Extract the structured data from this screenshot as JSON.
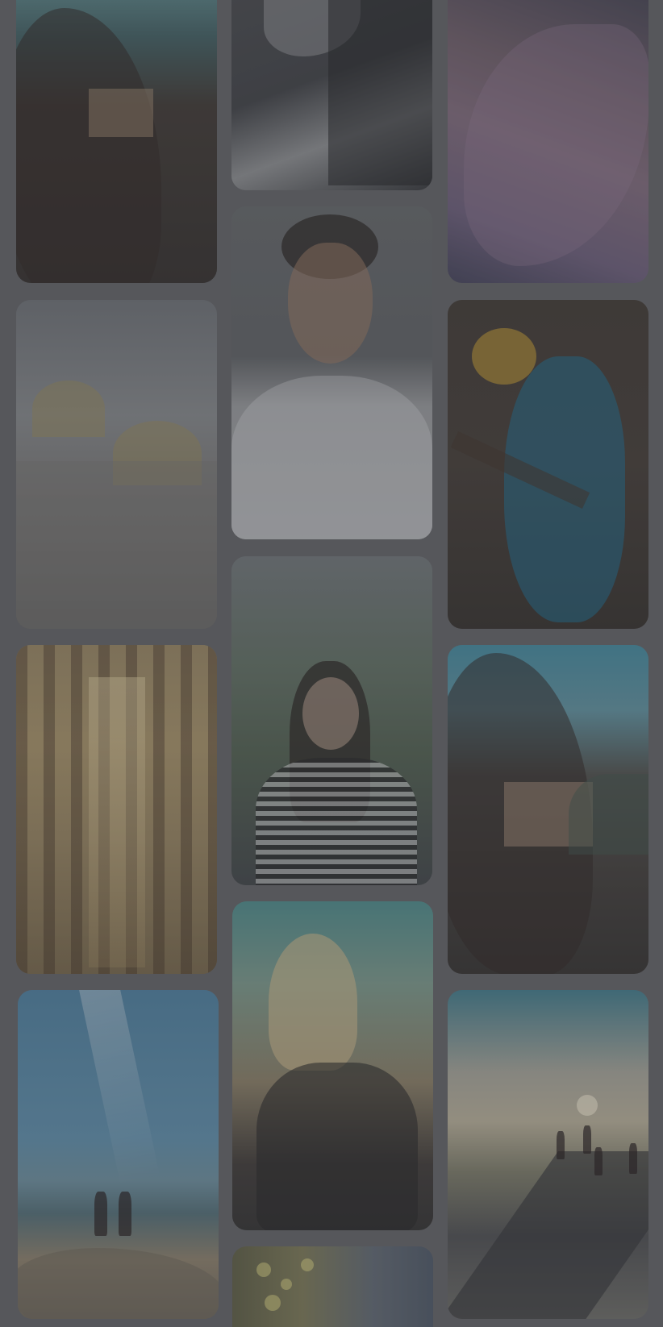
{
  "gallery": {
    "tiles": [
      {
        "id": "monastery-top",
        "subject": "cliffside-monastery-photo"
      },
      {
        "id": "woman-bw",
        "subject": "woman-portrait-photo"
      },
      {
        "id": "canyon",
        "subject": "canyon-rock-photo"
      },
      {
        "id": "cathedral",
        "subject": "cathedral-domes-photo"
      },
      {
        "id": "man-smile",
        "subject": "smiling-man-portrait-photo"
      },
      {
        "id": "parrot",
        "subject": "macaw-parrot-photo"
      },
      {
        "id": "sagrada",
        "subject": "cathedral-interior-photo"
      },
      {
        "id": "woman-stripes",
        "subject": "woman-striped-shirt-photo"
      },
      {
        "id": "monastery-bottom",
        "subject": "cliffside-monastery-photo"
      },
      {
        "id": "hikers-sky",
        "subject": "hikers-mountain-photo"
      },
      {
        "id": "woman-laughing",
        "subject": "laughing-woman-photo"
      },
      {
        "id": "road-runners",
        "subject": "runners-road-photo"
      },
      {
        "id": "lights",
        "subject": "bokeh-lights-photo"
      }
    ],
    "overlay_color": "#46484e"
  }
}
